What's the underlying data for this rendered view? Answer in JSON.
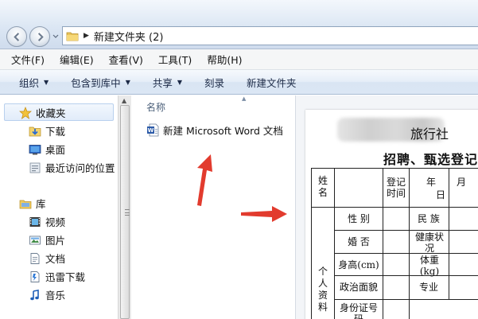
{
  "address": {
    "path_label": "新建文件夹 (2)"
  },
  "menu": [
    "文件(F)",
    "编辑(E)",
    "查看(V)",
    "工具(T)",
    "帮助(H)"
  ],
  "commands": [
    {
      "label": "组织",
      "dropdown": true
    },
    {
      "label": "包含到库中",
      "dropdown": true
    },
    {
      "label": "共享",
      "dropdown": true
    },
    {
      "label": "刻录",
      "dropdown": false
    },
    {
      "label": "新建文件夹",
      "dropdown": false
    }
  ],
  "nav": {
    "favorites": {
      "label": "收藏夹",
      "items": [
        "下载",
        "桌面",
        "最近访问的位置"
      ]
    },
    "library": {
      "label": "库",
      "items": [
        "视频",
        "图片",
        "文档",
        "迅雷下载",
        "音乐"
      ]
    }
  },
  "filelist": {
    "column_name": "名称",
    "file_name": "新建 Microsoft Word 文档"
  },
  "preview": {
    "title_visible": "旅行社",
    "subtitle_visible": "招聘、甄选登记",
    "table": {
      "name": "姓名",
      "reg_time": "登记时间",
      "year": "年",
      "month": "月",
      "day": "日",
      "gender": "性 别",
      "ethnicity": "民 族",
      "marriage": "婚 否",
      "health": "健康状况",
      "height": "身高(cm)",
      "weight": "体重(kg)",
      "politics": "政治面貌",
      "major": "专业",
      "id_number": "身份证号码",
      "personal_info": "个人资料"
    }
  },
  "colors": {
    "annotation_arrow": "#e23b2e",
    "cmd_text": "#1c2a47"
  }
}
